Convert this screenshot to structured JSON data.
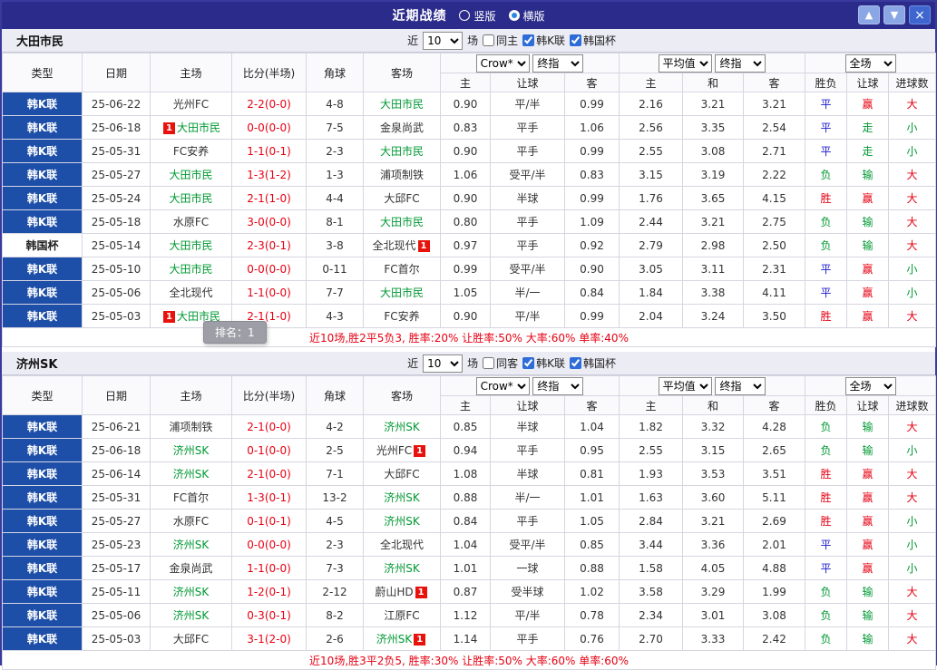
{
  "titlebar": {
    "title": "近期战绩",
    "radios": [
      {
        "label": "竖版",
        "selected": false
      },
      {
        "label": "横版",
        "selected": true
      }
    ],
    "up_icon": "▲",
    "down_icon": "▼",
    "close_icon": "×"
  },
  "header": {
    "main_cols": [
      "类型",
      "日期",
      "主场",
      "比分(半场)",
      "角球",
      "客场"
    ],
    "odds_group": [
      "Crow*",
      "终指"
    ],
    "avg_group": [
      "平均值",
      "终指"
    ],
    "result_group": [
      "全场"
    ],
    "sub_cols": [
      "主",
      "让球",
      "客",
      "主",
      "和",
      "客",
      "胜负",
      "让球",
      "进球数"
    ]
  },
  "value_colors": {
    "胜": "#e60012",
    "平": "#1a1acc",
    "负": "#009933",
    "赢": "#e60012",
    "走": "#009933",
    "输": "#009933",
    "大": "#e60012",
    "小": "#009933"
  },
  "tooltip": "排名：1",
  "sections": [
    {
      "team": "大田市民",
      "filter": {
        "near_label": "近",
        "count": "10",
        "games_label": "场",
        "same_label": "同主",
        "same_checked": false,
        "k_label": "韩K联",
        "k_checked": true,
        "cup_label": "韩国杯",
        "cup_checked": true
      },
      "rows": [
        {
          "league": "韩K联",
          "date": "25-06-22",
          "home": "光州FC",
          "home_focal": false,
          "home_badge": null,
          "score": "2-2(0-0)",
          "corners": "4-8",
          "away": "大田市民",
          "away_focal": true,
          "away_badge": null,
          "odds_home": "0.90",
          "handicap": "平/半",
          "odds_away": "0.99",
          "avg_home": "2.16",
          "avg_draw": "3.21",
          "avg_away": "3.21",
          "result": "平",
          "handicap_result": "赢",
          "goals": "大"
        },
        {
          "league": "韩K联",
          "date": "25-06-18",
          "home": "大田市民",
          "home_focal": true,
          "home_badge": "1",
          "score": "0-0(0-0)",
          "corners": "7-5",
          "away": "金泉尚武",
          "away_focal": false,
          "away_badge": null,
          "odds_home": "0.83",
          "handicap": "平手",
          "odds_away": "1.06",
          "avg_home": "2.56",
          "avg_draw": "3.35",
          "avg_away": "2.54",
          "result": "平",
          "handicap_result": "走",
          "goals": "小"
        },
        {
          "league": "韩K联",
          "date": "25-05-31",
          "home": "FC安养",
          "home_focal": false,
          "home_badge": null,
          "score": "1-1(0-1)",
          "corners": "2-3",
          "away": "大田市民",
          "away_focal": true,
          "away_badge": null,
          "odds_home": "0.90",
          "handicap": "平手",
          "odds_away": "0.99",
          "avg_home": "2.55",
          "avg_draw": "3.08",
          "avg_away": "2.71",
          "result": "平",
          "handicap_result": "走",
          "goals": "小"
        },
        {
          "league": "韩K联",
          "date": "25-05-27",
          "home": "大田市民",
          "home_focal": true,
          "home_badge": null,
          "score": "1-3(1-2)",
          "corners": "1-3",
          "away": "浦项制铁",
          "away_focal": false,
          "away_badge": null,
          "odds_home": "1.06",
          "handicap": "受平/半",
          "odds_away": "0.83",
          "avg_home": "3.15",
          "avg_draw": "3.19",
          "avg_away": "2.22",
          "result": "负",
          "handicap_result": "输",
          "goals": "大"
        },
        {
          "league": "韩K联",
          "date": "25-05-24",
          "home": "大田市民",
          "home_focal": true,
          "home_badge": null,
          "score": "2-1(1-0)",
          "corners": "4-4",
          "away": "大邱FC",
          "away_focal": false,
          "away_badge": null,
          "odds_home": "0.90",
          "handicap": "半球",
          "odds_away": "0.99",
          "avg_home": "1.76",
          "avg_draw": "3.65",
          "avg_away": "4.15",
          "result": "胜",
          "handicap_result": "赢",
          "goals": "大"
        },
        {
          "league": "韩K联",
          "date": "25-05-18",
          "home": "水原FC",
          "home_focal": false,
          "home_badge": null,
          "score": "3-0(0-0)",
          "corners": "8-1",
          "away": "大田市民",
          "away_focal": true,
          "away_badge": null,
          "odds_home": "0.80",
          "handicap": "平手",
          "odds_away": "1.09",
          "avg_home": "2.44",
          "avg_draw": "3.21",
          "avg_away": "2.75",
          "result": "负",
          "handicap_result": "输",
          "goals": "大"
        },
        {
          "league": "韩国杯",
          "date": "25-05-14",
          "home": "大田市民",
          "home_focal": true,
          "home_badge": null,
          "score": "2-3(0-1)",
          "corners": "3-8",
          "away": "全北现代",
          "away_focal": false,
          "away_badge": "1",
          "odds_home": "0.97",
          "handicap": "平手",
          "odds_away": "0.92",
          "avg_home": "2.79",
          "avg_draw": "2.98",
          "avg_away": "2.50",
          "result": "负",
          "handicap_result": "输",
          "goals": "大"
        },
        {
          "league": "韩K联",
          "date": "25-05-10",
          "home": "大田市民",
          "home_focal": true,
          "home_badge": null,
          "score": "0-0(0-0)",
          "corners": "0-11",
          "away": "FC首尔",
          "away_focal": false,
          "away_badge": null,
          "odds_home": "0.99",
          "handicap": "受平/半",
          "odds_away": "0.90",
          "avg_home": "3.05",
          "avg_draw": "3.11",
          "avg_away": "2.31",
          "result": "平",
          "handicap_result": "赢",
          "goals": "小"
        },
        {
          "league": "韩K联",
          "date": "25-05-06",
          "home": "全北现代",
          "home_focal": false,
          "home_badge": null,
          "score": "1-1(0-0)",
          "corners": "7-7",
          "away": "大田市民",
          "away_focal": true,
          "away_badge": null,
          "odds_home": "1.05",
          "handicap": "半/一",
          "odds_away": "0.84",
          "avg_home": "1.84",
          "avg_draw": "3.38",
          "avg_away": "4.11",
          "result": "平",
          "handicap_result": "赢",
          "goals": "小"
        },
        {
          "league": "韩K联",
          "date": "25-05-03",
          "home": "大田市民",
          "home_focal": true,
          "home_badge": "1",
          "score": "2-1(1-0)",
          "corners": "4-3",
          "away": "FC安养",
          "away_focal": false,
          "away_badge": null,
          "odds_home": "0.90",
          "handicap": "平/半",
          "odds_away": "0.99",
          "avg_home": "2.04",
          "avg_draw": "3.24",
          "avg_away": "3.50",
          "result": "胜",
          "handicap_result": "赢",
          "goals": "大"
        }
      ],
      "footer": "近10场,胜2平5负3, 胜率:20% 让胜率:50% 大率:60% 单率:40%"
    },
    {
      "team": "济州SK",
      "filter": {
        "near_label": "近",
        "count": "10",
        "games_label": "场",
        "same_label": "同客",
        "same_checked": false,
        "k_label": "韩K联",
        "k_checked": true,
        "cup_label": "韩国杯",
        "cup_checked": true
      },
      "rows": [
        {
          "league": "韩K联",
          "date": "25-06-21",
          "home": "浦项制铁",
          "home_focal": false,
          "home_badge": null,
          "score": "2-1(0-0)",
          "corners": "4-2",
          "away": "济州SK",
          "away_focal": true,
          "away_badge": null,
          "odds_home": "0.85",
          "handicap": "半球",
          "odds_away": "1.04",
          "avg_home": "1.82",
          "avg_draw": "3.32",
          "avg_away": "4.28",
          "result": "负",
          "handicap_result": "输",
          "goals": "大"
        },
        {
          "league": "韩K联",
          "date": "25-06-18",
          "home": "济州SK",
          "home_focal": true,
          "home_badge": null,
          "score": "0-1(0-0)",
          "corners": "2-5",
          "away": "光州FC",
          "away_focal": false,
          "away_badge": "1",
          "odds_home": "0.94",
          "handicap": "平手",
          "odds_away": "0.95",
          "avg_home": "2.55",
          "avg_draw": "3.15",
          "avg_away": "2.65",
          "result": "负",
          "handicap_result": "输",
          "goals": "小"
        },
        {
          "league": "韩K联",
          "date": "25-06-14",
          "home": "济州SK",
          "home_focal": true,
          "home_badge": null,
          "score": "2-1(0-0)",
          "corners": "7-1",
          "away": "大邱FC",
          "away_focal": false,
          "away_badge": null,
          "odds_home": "1.08",
          "handicap": "半球",
          "odds_away": "0.81",
          "avg_home": "1.93",
          "avg_draw": "3.53",
          "avg_away": "3.51",
          "result": "胜",
          "handicap_result": "赢",
          "goals": "大"
        },
        {
          "league": "韩K联",
          "date": "25-05-31",
          "home": "FC首尔",
          "home_focal": false,
          "home_badge": null,
          "score": "1-3(0-1)",
          "corners": "13-2",
          "away": "济州SK",
          "away_focal": true,
          "away_badge": null,
          "odds_home": "0.88",
          "handicap": "半/一",
          "odds_away": "1.01",
          "avg_home": "1.63",
          "avg_draw": "3.60",
          "avg_away": "5.11",
          "result": "胜",
          "handicap_result": "赢",
          "goals": "大"
        },
        {
          "league": "韩K联",
          "date": "25-05-27",
          "home": "水原FC",
          "home_focal": false,
          "home_badge": null,
          "score": "0-1(0-1)",
          "corners": "4-5",
          "away": "济州SK",
          "away_focal": true,
          "away_badge": null,
          "odds_home": "0.84",
          "handicap": "平手",
          "odds_away": "1.05",
          "avg_home": "2.84",
          "avg_draw": "3.21",
          "avg_away": "2.69",
          "result": "胜",
          "handicap_result": "赢",
          "goals": "小"
        },
        {
          "league": "韩K联",
          "date": "25-05-23",
          "home": "济州SK",
          "home_focal": true,
          "home_badge": null,
          "score": "0-0(0-0)",
          "corners": "2-3",
          "away": "全北现代",
          "away_focal": false,
          "away_badge": null,
          "odds_home": "1.04",
          "handicap": "受平/半",
          "odds_away": "0.85",
          "avg_home": "3.44",
          "avg_draw": "3.36",
          "avg_away": "2.01",
          "result": "平",
          "handicap_result": "赢",
          "goals": "小"
        },
        {
          "league": "韩K联",
          "date": "25-05-17",
          "home": "金泉尚武",
          "home_focal": false,
          "home_badge": null,
          "score": "1-1(0-0)",
          "corners": "7-3",
          "away": "济州SK",
          "away_focal": true,
          "away_badge": null,
          "odds_home": "1.01",
          "handicap": "一球",
          "odds_away": "0.88",
          "avg_home": "1.58",
          "avg_draw": "4.05",
          "avg_away": "4.88",
          "result": "平",
          "handicap_result": "赢",
          "goals": "小"
        },
        {
          "league": "韩K联",
          "date": "25-05-11",
          "home": "济州SK",
          "home_focal": true,
          "home_badge": null,
          "score": "1-2(0-1)",
          "corners": "2-12",
          "away": "蔚山HD",
          "away_focal": false,
          "away_badge": "1",
          "odds_home": "0.87",
          "handicap": "受半球",
          "odds_away": "1.02",
          "avg_home": "3.58",
          "avg_draw": "3.29",
          "avg_away": "1.99",
          "result": "负",
          "handicap_result": "输",
          "goals": "大"
        },
        {
          "league": "韩K联",
          "date": "25-05-06",
          "home": "济州SK",
          "home_focal": true,
          "home_badge": null,
          "score": "0-3(0-1)",
          "corners": "8-2",
          "away": "江原FC",
          "away_focal": false,
          "away_badge": null,
          "odds_home": "1.12",
          "handicap": "平/半",
          "odds_away": "0.78",
          "avg_home": "2.34",
          "avg_draw": "3.01",
          "avg_away": "3.08",
          "result": "负",
          "handicap_result": "输",
          "goals": "大"
        },
        {
          "league": "韩K联",
          "date": "25-05-03",
          "home": "大邱FC",
          "home_focal": false,
          "home_badge": null,
          "score": "3-1(2-0)",
          "corners": "2-6",
          "away": "济州SK",
          "away_focal": true,
          "away_badge": "1",
          "odds_home": "1.14",
          "handicap": "平手",
          "odds_away": "0.76",
          "avg_home": "2.70",
          "avg_draw": "3.33",
          "avg_away": "2.42",
          "result": "负",
          "handicap_result": "输",
          "goals": "大"
        }
      ],
      "footer": "近10场,胜3平2负5, 胜率:30% 让胜率:50% 大率:60% 单率:60%"
    }
  ]
}
